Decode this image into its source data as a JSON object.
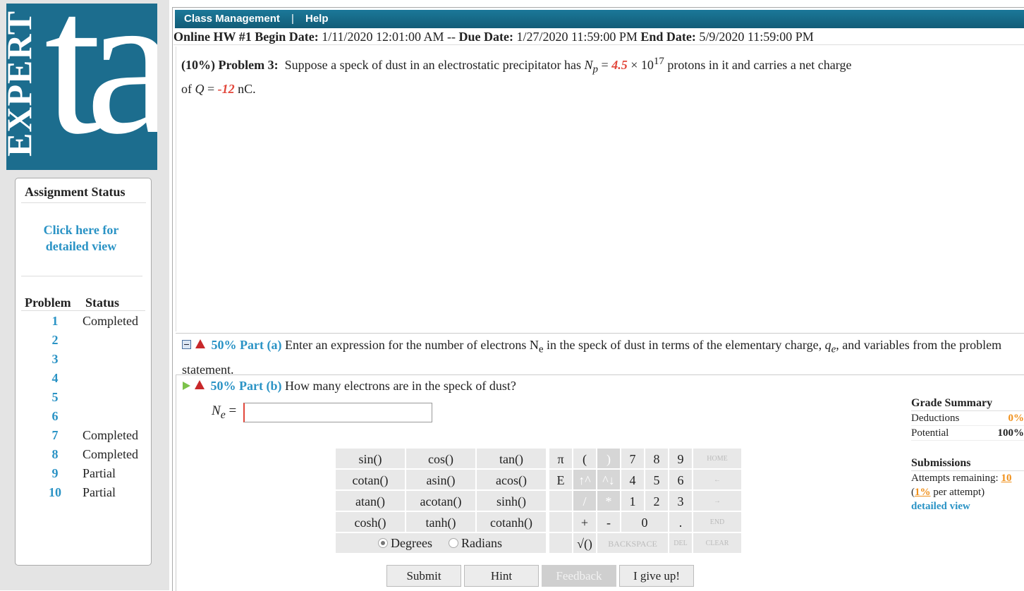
{
  "logo": {
    "word": "EXPERT",
    "mark": "ta",
    "color": "#1c6d8e"
  },
  "sidebar": {
    "title": "Assignment Status",
    "detail_link": "Click here for detailed view",
    "col_problem": "Problem",
    "col_status": "Status",
    "problems": [
      {
        "num": "1",
        "status": "Completed"
      },
      {
        "num": "2",
        "status": ""
      },
      {
        "num": "3",
        "status": ""
      },
      {
        "num": "4",
        "status": ""
      },
      {
        "num": "5",
        "status": ""
      },
      {
        "num": "6",
        "status": ""
      },
      {
        "num": "7",
        "status": "Completed"
      },
      {
        "num": "8",
        "status": "Completed"
      },
      {
        "num": "9",
        "status": "Partial"
      },
      {
        "num": "10",
        "status": "Partial"
      }
    ]
  },
  "menu": {
    "class_mgmt": "Class Management",
    "sep": "|",
    "help": "Help"
  },
  "header": {
    "title": "Online HW #1",
    "begin_label": "Begin Date:",
    "begin": "1/11/2020 12:01:00 AM",
    "dash": "--",
    "due_label": "Due Date:",
    "due": "1/27/2020 11:59:00 PM",
    "end_label": "End Date:",
    "end": "5/9/2020 11:59:00 PM"
  },
  "problem": {
    "weight": "(10%)",
    "label": "Problem 3:",
    "text1": "Suppose a speck of dust in an electrostatic precipitator has",
    "np_sym": "N",
    "np_sub": "p",
    "eq": "=",
    "np_val": "4.5",
    "times": "× 10",
    "exp": "17",
    "text2": "protons in it and carries a net charge",
    "text3": "of",
    "q_sym": "Q",
    "q_val": "-12",
    "q_unit": "nC."
  },
  "part_a": {
    "label": "50% Part (a)",
    "text": "Enter an expression for the number of electrons N",
    "sub": "e",
    "text2": "in the speck of dust in terms of the elementary charge,",
    "qe": "q",
    "qe_sub": "e",
    "text3": ", and variables from the problem statement."
  },
  "part_b": {
    "label": "50% Part (b)",
    "text": "How many electrons are in the speck of dust?",
    "var": "N",
    "var_sub": "e",
    "eq": "=",
    "input_value": ""
  },
  "calc": {
    "funcs": [
      [
        "sin()",
        "cos()",
        "tan()"
      ],
      [
        "cotan()",
        "asin()",
        "acos()"
      ],
      [
        "atan()",
        "acotan()",
        "sinh()"
      ],
      [
        "cosh()",
        "tanh()",
        "cotanh()"
      ]
    ],
    "keys": {
      "pi": "π",
      "lparen": "(",
      "rparen": ")",
      "n7": "7",
      "n8": "8",
      "n9": "9",
      "home": "HOME",
      "E": "E",
      "up1": "↑^",
      "up2": "^↓",
      "n4": "4",
      "n5": "5",
      "n6": "6",
      "left": "←",
      "slash": "/",
      "star": "*",
      "n1": "1",
      "n2": "2",
      "n3": "3",
      "right": "→",
      "plus": "+",
      "minus": "-",
      "n0": "0",
      "dot": ".",
      "end": "END",
      "sqrt": "√()",
      "backspace": "BACKSPACE",
      "del": "DEL",
      "clear": "CLEAR"
    },
    "degrees": "Degrees",
    "radians": "Radians"
  },
  "actions": {
    "submit": "Submit",
    "hint": "Hint",
    "feedback": "Feedback",
    "giveup": "I give up!"
  },
  "grade": {
    "title": "Grade Summary",
    "deductions_label": "Deductions",
    "deductions": "0%",
    "potential_label": "Potential",
    "potential": "100%",
    "submissions_title": "Submissions",
    "attempts_label": "Attempts remaining:",
    "attempts": "10",
    "per_open": "(",
    "per_val": "1%",
    "per_text": "per attempt)",
    "detail": "detailed view"
  }
}
